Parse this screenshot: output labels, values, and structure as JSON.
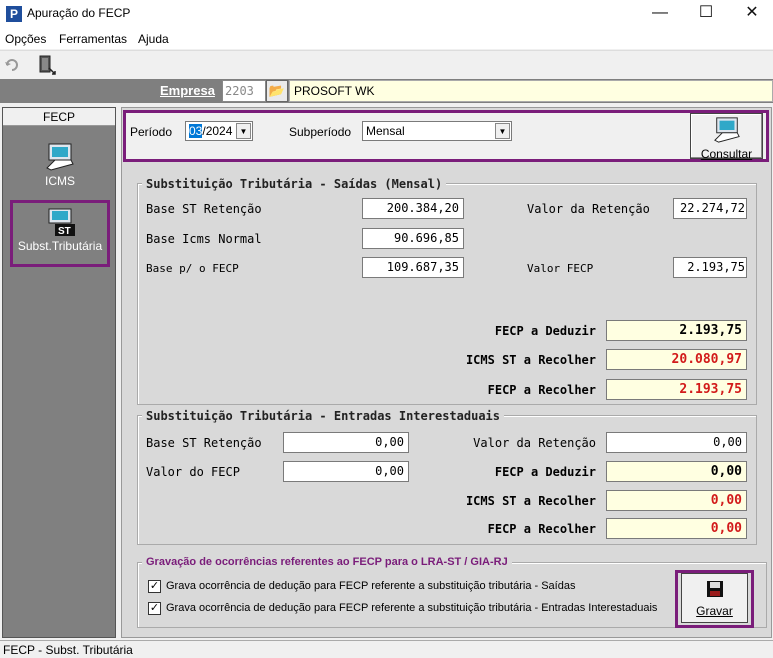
{
  "window": {
    "title": "Apuração do FECP",
    "app_icon_letter": "P",
    "minimize": "—",
    "maximize": "☐",
    "close": "✕"
  },
  "menu": [
    "Opções",
    "Ferramentas",
    "Ajuda"
  ],
  "empresa": {
    "label": "Empresa",
    "code": "2203",
    "name": "PROSOFT WK"
  },
  "sidebar": {
    "header": "FECP",
    "items": [
      {
        "label": "ICMS",
        "icon": "monitor-icon"
      },
      {
        "label": "Subst.Tributária",
        "icon": "st-monitor-icon"
      }
    ]
  },
  "filters": {
    "periodo_label": "Período",
    "periodo_value_sel": "03",
    "periodo_value_rest": "/2024",
    "subperiodo_label": "Subperíodo",
    "subperiodo_value": "Mensal",
    "consultar_label": "Consultar"
  },
  "saidas": {
    "title": "Substituição Tributária - Saídas (Mensal)",
    "base_st_retencao_label": "Base ST Retenção",
    "base_st_retencao": "200.384,20",
    "base_icms_normal_label": "Base Icms Normal",
    "base_icms_normal": "90.696,85",
    "base_fecp_label": "Base p/ o FECP",
    "base_fecp": "109.687,35",
    "valor_retencao_label": "Valor da Retenção",
    "valor_retencao": "22.274,72",
    "valor_fecp_label": "Valor FECP",
    "valor_fecp": "2.193,75",
    "fecp_deduzir_label": "FECP a Deduzir",
    "fecp_deduzir": "2.193,75",
    "icms_st_recolher_label": "ICMS ST a Recolher",
    "icms_st_recolher": "20.080,97",
    "fecp_recolher_label": "FECP a Recolher",
    "fecp_recolher": "2.193,75"
  },
  "entradas": {
    "title": "Substituição Tributária - Entradas Interestaduais",
    "base_st_retencao_label": "Base ST Retenção",
    "base_st_retencao": "0,00",
    "valor_fecp_label": "Valor do FECP",
    "valor_fecp": "0,00",
    "valor_retencao_label": "Valor da Retenção",
    "valor_retencao": "0,00",
    "fecp_deduzir_label": "FECP a Deduzir",
    "fecp_deduzir": "0,00",
    "icms_st_recolher_label": "ICMS ST a Recolher",
    "icms_st_recolher": "0,00",
    "fecp_recolher_label": "FECP a Recolher",
    "fecp_recolher": "0,00"
  },
  "gravacao": {
    "title": "Gravação de ocorrências referentes ao FECP  para o LRA-ST / GIA-RJ",
    "check1_label": "Grava ocorrência de dedução para FECP referente a substituição tributária - Saídas",
    "check1_checked": true,
    "check2_label": "Grava ocorrência de dedução para FECP referente a substituição tributária - Entradas Interestaduais",
    "check2_checked": true,
    "gravar_label": "Gravar"
  },
  "status": "FECP - Subst. Tributária",
  "colors": {
    "highlight_border": "#7a1d7a",
    "value_red": "#d21a1a",
    "yellow_field": "#ffffe1"
  }
}
